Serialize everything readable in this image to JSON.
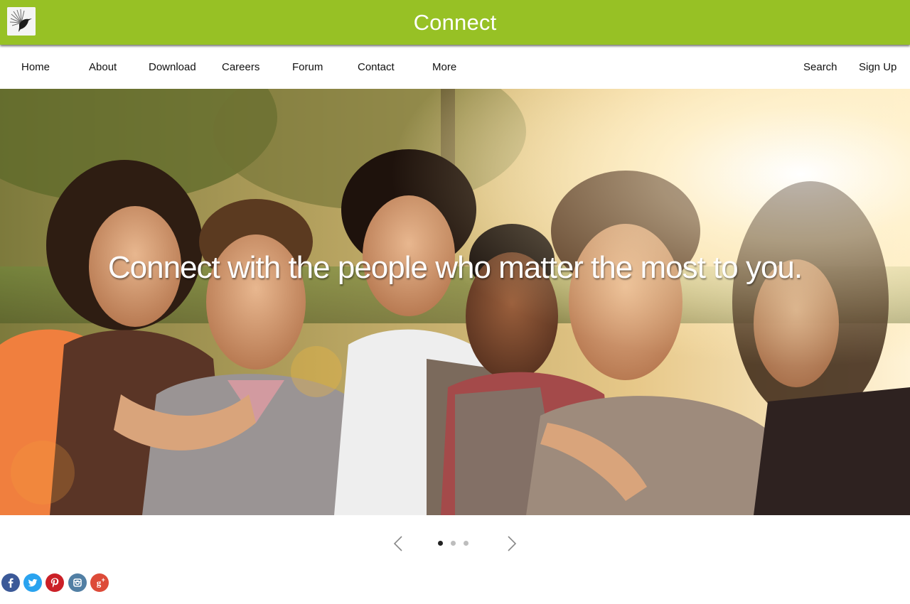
{
  "header": {
    "title": "Connect",
    "background_color": "#97c125",
    "logo_icon": "hummingbird-logo-icon"
  },
  "nav": {
    "left_items": [
      "Home",
      "About",
      "Download",
      "Careers",
      "Forum",
      "Contact",
      "More"
    ],
    "right_items": [
      "Search",
      "Sign Up"
    ]
  },
  "hero": {
    "caption": "Connect with the people who matter the most to you.",
    "image_description_icon": "group-of-friends-photo"
  },
  "slider": {
    "prev_icon": "chevron-left-icon",
    "next_icon": "chevron-right-icon",
    "slide_count": 3,
    "active_slide": 1
  },
  "social": {
    "icons": [
      {
        "name": "facebook-icon",
        "color": "#3b5998"
      },
      {
        "name": "twitter-icon",
        "color": "#2aa3ef"
      },
      {
        "name": "pinterest-icon",
        "color": "#cb2027"
      },
      {
        "name": "instagram-icon",
        "color": "#517fa4"
      },
      {
        "name": "google-plus-icon",
        "color": "#dd4b39"
      }
    ]
  }
}
